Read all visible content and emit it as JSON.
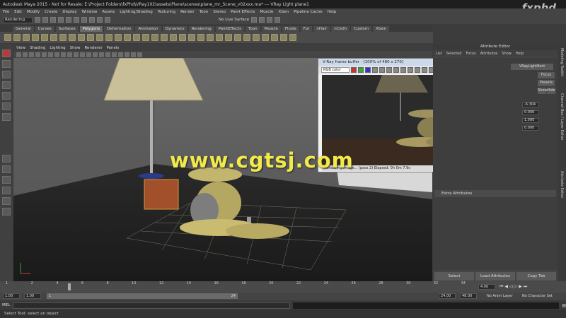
{
  "window": {
    "title": "Autodesk Maya 2015 - Not for Resale: E:\\Project Folders\\fxPhd\\VRay102\\assets\\Plane\\scenes\\plane_mr_Scene_v02xxx.ma* --- VRay Light plane1",
    "watermark": "fxphd"
  },
  "menubar": [
    "File",
    "Edit",
    "Modify",
    "Create",
    "Display",
    "Window",
    "Assets",
    "Lighting/Shading",
    "Texturing",
    "Render",
    "Toon",
    "Stereo",
    "Paint Effects",
    "Muscle",
    "XGen",
    "Pipeline Cache",
    "Help"
  ],
  "statusline": {
    "mode": "Rendering",
    "no_live_surface": "No Live Surface"
  },
  "shelf_tabs": [
    "General",
    "Curves",
    "Surfaces",
    "Polygons",
    "Deformation",
    "Animation",
    "Dynamics",
    "Rendering",
    "PaintEffects",
    "Toon",
    "Muscle",
    "Fluids",
    "Fur",
    "nHair",
    "nCloth",
    "Custom",
    "XGen"
  ],
  "shelf_active": "Polygons",
  "viewport_menu": [
    "View",
    "Shading",
    "Lighting",
    "Show",
    "Renderer",
    "Panels"
  ],
  "vfb": {
    "title": "V-Ray frame buffer - [100% of 480 x 270]",
    "channel": "RGB color",
    "status": "Rendering image... (pass 2)    Elapsed: 0h 0m 7.9s"
  },
  "attribute_editor": {
    "header": "Attribute Editor",
    "tabs": [
      "List",
      "Selected",
      "Focus",
      "Attributes",
      "Show",
      "Help"
    ],
    "node_tab": "VRayLightRect",
    "focus_label": "Focus",
    "presets_label": "Presets",
    "show_label": "Show",
    "hide_label": "Hide",
    "fields": [
      "-6.304",
      "0.000",
      "1.000",
      "0.000"
    ],
    "section": "Extra Attributes",
    "buttons": [
      "Select",
      "Load Attributes",
      "Copy Tab"
    ]
  },
  "side_tabs": [
    "Modeling Toolkit",
    "Channel Box / Layer Editor",
    "Attribute Editor"
  ],
  "time_slider": {
    "ticks": [
      "1",
      "2",
      "4",
      "6",
      "8",
      "10",
      "12",
      "14",
      "16",
      "18",
      "20",
      "22",
      "24",
      "26",
      "28",
      "30",
      "32",
      "34"
    ],
    "current_frame": "4.00"
  },
  "range": {
    "start": "1.00",
    "range_start": "1.00",
    "range_handle": "1",
    "range_end_handle": "24",
    "end": "24.00",
    "anim_end": "48.00",
    "anim_layer": "No Anim Layer",
    "character_set": "No Character Set"
  },
  "command_line": {
    "lang": "MEL"
  },
  "help_line": "Select Tool: select an object",
  "overlay_watermark": "www.cgtsj.com",
  "colors": {
    "accent": "#f2e94a",
    "viewport_bg": "#5e5e5e",
    "selected_tool": "#b83a3a"
  }
}
